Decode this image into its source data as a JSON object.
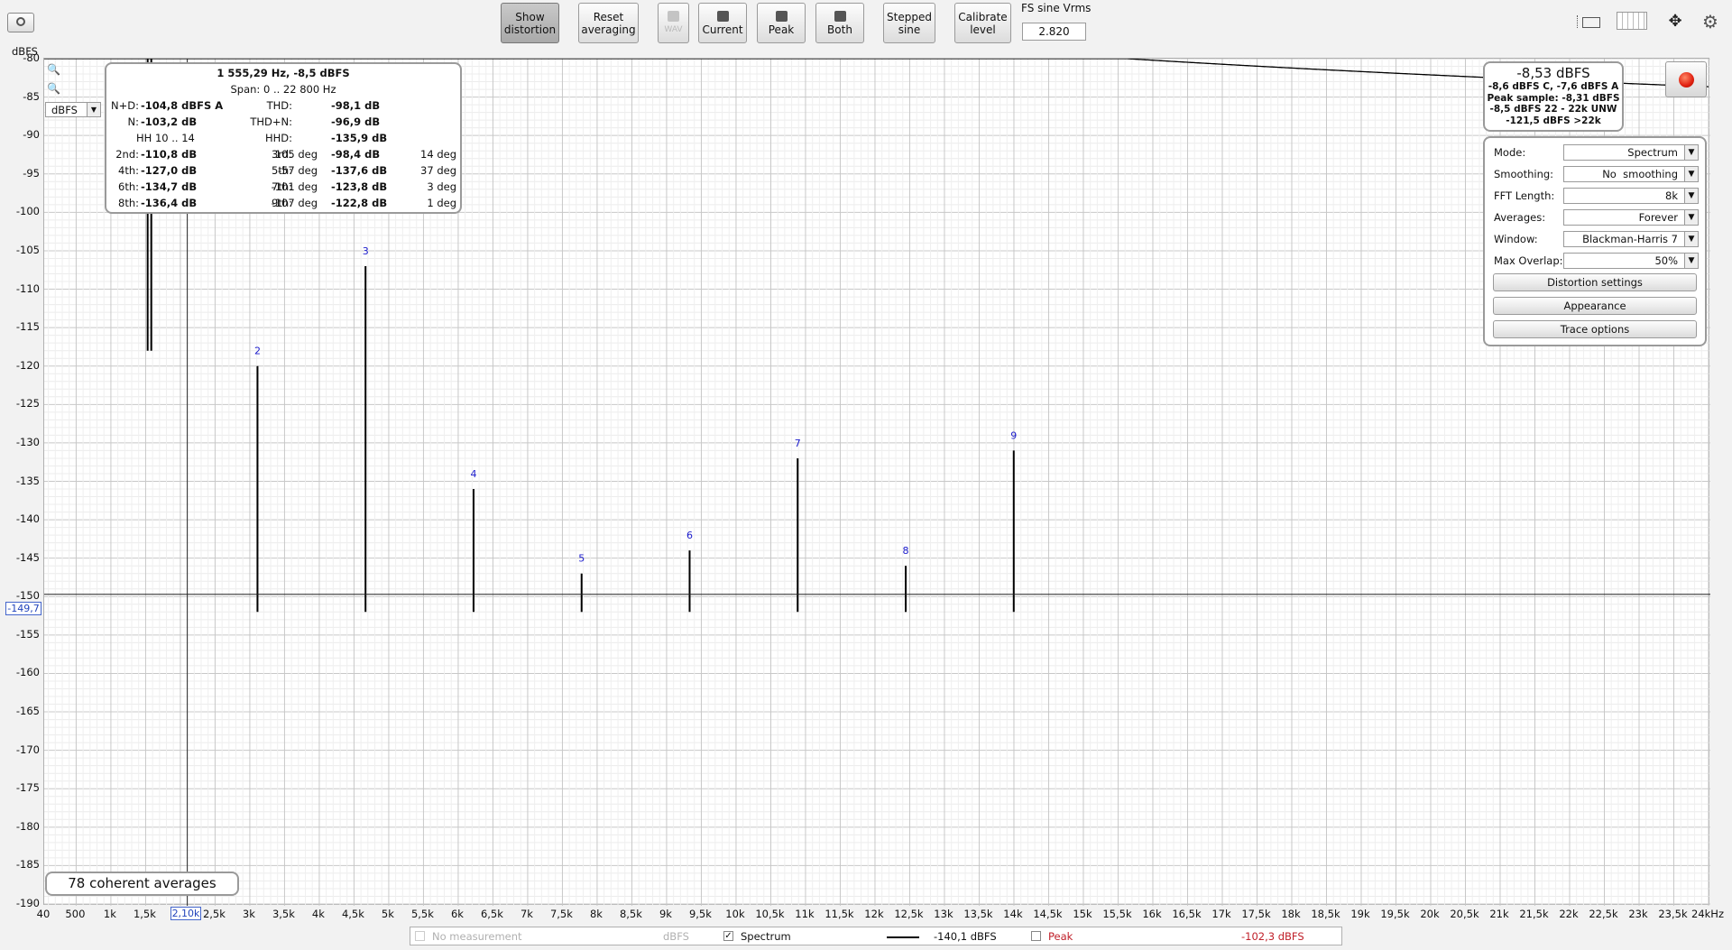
{
  "toolbar": {
    "show_distortion": "Show\ndistortion",
    "reset_averaging": "Reset\naveraging",
    "wav": "WAV",
    "current": "Current",
    "peak": "Peak",
    "both": "Both",
    "stepped_sine": "Stepped\nsine",
    "calibrate_level": "Calibrate\nlevel",
    "fs_sine_label": "FS sine Vrms",
    "fs_sine_value": "2.820"
  },
  "y_axis": {
    "unit": "dBFS",
    "ticks": [
      "-80",
      "-85",
      "-90",
      "-95",
      "-100",
      "-105",
      "-110",
      "-115",
      "-120",
      "-125",
      "-130",
      "-135",
      "-140",
      "-145",
      "-150",
      "-155",
      "-160",
      "-165",
      "-170",
      "-175",
      "-180",
      "-185",
      "-190"
    ],
    "unit_select": "dBFS",
    "cursor_value": "-149,7"
  },
  "x_axis": {
    "ticks": [
      "40",
      "500",
      "1k",
      "1,5k",
      "2k",
      "2,5k",
      "3k",
      "3,5k",
      "4k",
      "4,5k",
      "5k",
      "5,5k",
      "6k",
      "6,5k",
      "7k",
      "7,5k",
      "8k",
      "8,5k",
      "9k",
      "9,5k",
      "10k",
      "10,5k",
      "11k",
      "11,5k",
      "12k",
      "12,5k",
      "13k",
      "13,5k",
      "14k",
      "14,5k",
      "15k",
      "15,5k",
      "16k",
      "16,5k",
      "17k",
      "17,5k",
      "18k",
      "18,5k",
      "19k",
      "19,5k",
      "20k",
      "20,5k",
      "21k",
      "21,5k",
      "22k",
      "22,5k",
      "23k",
      "23,5k",
      "24kHz"
    ],
    "cursor_value": "2,10k"
  },
  "distortion": {
    "header": "1 555,29 Hz, -8,5 dBFS",
    "span": "Span:  0 .. 22 800 Hz",
    "nd_label": "N+D:",
    "nd_value": "-104,8 dBFS A",
    "thd_label": "THD:",
    "thd_value": "-98,1 dB",
    "n_label": "N:",
    "n_value": "-103,2 dB",
    "thdn_label": "THD+N:",
    "thdn_value": "-96,9 dB",
    "hh_label": "HH 10 .. 14",
    "hhd_label": "HHD:",
    "hhd_value": "-135,9 dB",
    "harmonics": [
      {
        "label": "2nd:",
        "value": "-110,8 dB",
        "phase": "105 deg"
      },
      {
        "label": "3rd:",
        "value": "-98,4 dB",
        "phase": "14 deg"
      },
      {
        "label": "4th:",
        "value": "-127,0 dB",
        "phase": "-57 deg"
      },
      {
        "label": "5th:",
        "value": "-137,6 dB",
        "phase": "37 deg"
      },
      {
        "label": "6th:",
        "value": "-134,7 dB",
        "phase": "-101 deg"
      },
      {
        "label": "7th:",
        "value": "-123,8 dB",
        "phase": "3 deg"
      },
      {
        "label": "8th:",
        "value": "-136,4 dB",
        "phase": "-107 deg"
      },
      {
        "label": "9th:",
        "value": "-122,8 dB",
        "phase": "1 deg"
      }
    ]
  },
  "level": {
    "main": "-8,53 dBFS",
    "line1": "-8,6 dBFS C, -7,6 dBFS A",
    "line2": "Peak sample: -8,31 dBFS",
    "line3": "-8,5 dBFS 22 - 22k UNW",
    "line4": "-121,5 dBFS >22k"
  },
  "settings": {
    "mode_label": "Mode:",
    "mode_value": "Spectrum",
    "smoothing_label": "Smoothing:",
    "smoothing_value": "No  smoothing",
    "fft_label": "FFT Length:",
    "fft_value": "8k",
    "averages_label": "Averages:",
    "averages_value": "Forever",
    "window_label": "Window:",
    "window_value": "Blackman-Harris 7",
    "overlap_label": "Max Overlap:",
    "overlap_value": "50%",
    "distortion_settings": "Distortion settings",
    "appearance": "Appearance",
    "trace_options": "Trace options"
  },
  "averages_badge": "78 coherent averages",
  "legend": {
    "no_measurement": "No measurement",
    "no_measurement_unit": "dBFS",
    "spectrum": "Spectrum",
    "spectrum_value": "-140,1 dBFS",
    "peak": "Peak",
    "peak_value": "-102,3 dBFS"
  },
  "colors": {
    "peak": "#c0202a",
    "harmonic_label": "#1a1acc",
    "trace": "#000000",
    "record": "#e02010"
  },
  "chart_data": {
    "type": "line",
    "title": "",
    "xlabel": "",
    "ylabel": "dBFS",
    "xlim": [
      40,
      24000
    ],
    "ylim": [
      -190,
      -80
    ],
    "x_scale": "linear",
    "grid": true,
    "fundamental_hz": 1555.29,
    "harmonics": [
      {
        "label": "2",
        "freq_hz": 3110.6,
        "level_db": -120
      },
      {
        "label": "3",
        "freq_hz": 4665.9,
        "level_db": -107
      },
      {
        "label": "4",
        "freq_hz": 6221.2,
        "level_db": -136
      },
      {
        "label": "5",
        "freq_hz": 7776.5,
        "level_db": -147
      },
      {
        "label": "6",
        "freq_hz": 9331.7,
        "level_db": -144
      },
      {
        "label": "7",
        "freq_hz": 10887.0,
        "level_db": -132
      },
      {
        "label": "8",
        "freq_hz": 12442.3,
        "level_db": -146
      },
      {
        "label": "9",
        "freq_hz": 13997.6,
        "level_db": -131
      }
    ],
    "noise_floor_db": -160,
    "cursor": {
      "x_hz": 2100,
      "y_db": -149.7
    }
  }
}
